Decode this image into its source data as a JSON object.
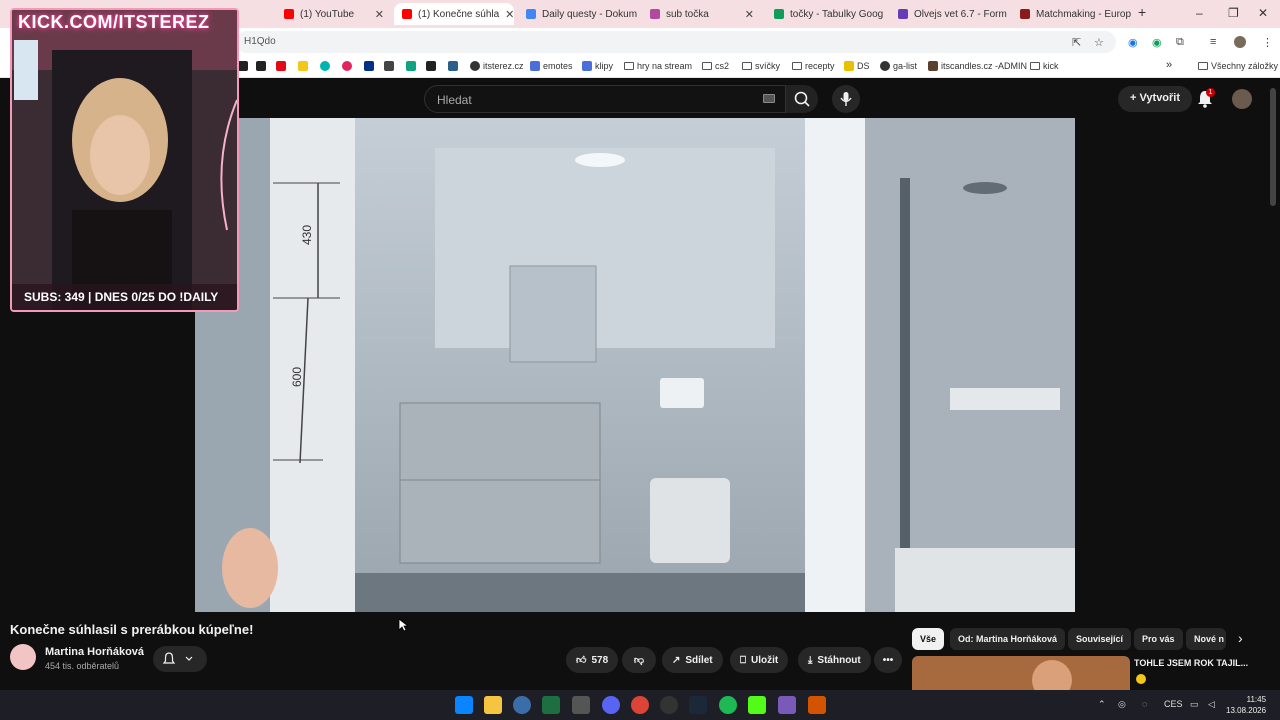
{
  "browser": {
    "tabs": [
      {
        "label": "(1) YouTube",
        "color": "#ff0000"
      },
      {
        "label": "(1) Konečne súhla",
        "color": "#ff0000",
        "active": true
      },
      {
        "label": "Daily questy - Dokum",
        "color": "#4285f4"
      },
      {
        "label": "sub točka",
        "color": "#b04a9c"
      },
      {
        "label": "točky - Tabulky Goog",
        "color": "#0f9d58"
      },
      {
        "label": "Olvejs vet 6.7 - Form",
        "color": "#673ab7"
      },
      {
        "label": "Matchmaking - Europ",
        "color": "#8b1a1a"
      }
    ],
    "address": "H1Qdo",
    "bookmarks": [
      {
        "label": "itsterez.cz",
        "kind": "site"
      },
      {
        "label": "emotes",
        "kind": "site"
      },
      {
        "label": "klipy",
        "kind": "site"
      },
      {
        "label": "hry na stream",
        "kind": "folder"
      },
      {
        "label": "cs2",
        "kind": "folder"
      },
      {
        "label": "svíčky",
        "kind": "folder"
      },
      {
        "label": "recepty",
        "kind": "folder"
      },
      {
        "label": "DS",
        "kind": "site"
      },
      {
        "label": "ga-list",
        "kind": "site"
      },
      {
        "label": "itscandles.cz -ADMIN",
        "kind": "site"
      },
      {
        "label": "kick",
        "kind": "folder"
      }
    ],
    "all_bookmarks": "Všechny záložky"
  },
  "youtube": {
    "search_placeholder": "Hledat",
    "create_label": "Vytvořit",
    "notification_count": "1",
    "video": {
      "dimension_top": "430",
      "dimension_bottom": "600"
    },
    "title": "Konečne súhlasil s prerábkou kúpeľne!",
    "channel": {
      "name": "Martina Horňáková",
      "subscribers": "454 tis. odběratelů"
    },
    "actions": {
      "likes": "578",
      "share": "Sdílet",
      "save": "Uložit",
      "download": "Stáhnout"
    },
    "chips": [
      "Vše",
      "Od: Martina Horňáková",
      "Související",
      "Pro vás",
      "Nové n"
    ],
    "recommendation": {
      "title": "TOHLE JSEM ROK TAJIL..."
    }
  },
  "stream_overlay": {
    "url": "KICK.COM/ITSTEREZ",
    "subs": "SUBS: 349 | DNES 0/25 DO !DAILY"
  },
  "taskbar": {
    "language": "CES",
    "time": "11:45",
    "date": "13.08.2026"
  }
}
